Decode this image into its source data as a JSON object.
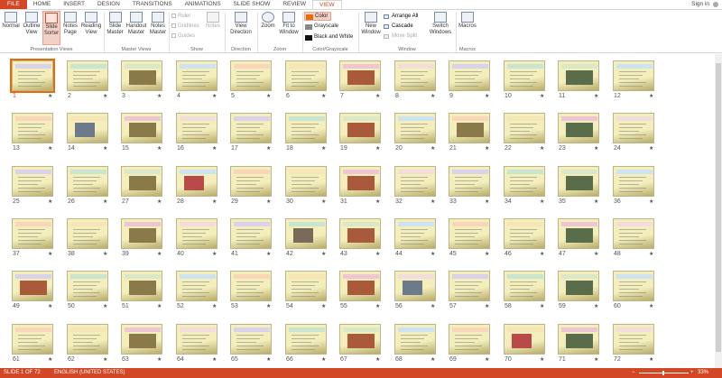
{
  "tabs": [
    "FILE",
    "HOME",
    "INSERT",
    "DESIGN",
    "TRANSITIONS",
    "ANIMATIONS",
    "SLIDE SHOW",
    "REVIEW",
    "VIEW"
  ],
  "signin": "Sign in",
  "ribbon": {
    "presentation_views": {
      "label": "Presentation Views",
      "buttons": [
        "Normal",
        "Outline View",
        "Slide Sorter",
        "Notes Page",
        "Reading View"
      ]
    },
    "master_views": {
      "label": "Master Views",
      "buttons": [
        "Slide Master",
        "Handout Master",
        "Notes Master"
      ]
    },
    "show": {
      "label": "Show",
      "checks": [
        "Ruler",
        "Gridlines",
        "Guides"
      ],
      "notes": "Notes"
    },
    "direction": {
      "label": "Direction",
      "button": "View Direction"
    },
    "zoom": {
      "label": "Zoom",
      "buttons": [
        "Zoom",
        "Fit to Window"
      ]
    },
    "color": {
      "label": "Color/Grayscale",
      "options": [
        "Color",
        "Grayscale",
        "Black and White"
      ],
      "swatches": [
        "#e46c0a",
        "#888888",
        "#111111"
      ]
    },
    "window": {
      "label": "Window",
      "new_window": "New Window",
      "small": [
        "Arrange All",
        "Cascade",
        "Move Split"
      ],
      "switch": "Switch Windows"
    },
    "macros": {
      "label": "Macros",
      "button": "Macros"
    }
  },
  "slides": {
    "count": 72,
    "selected": 1,
    "star": "★"
  },
  "status": {
    "slide": "SLIDE 1 OF 72",
    "language": "ENGLISH (UNITED STATES)",
    "zoom": "33%",
    "minus": "−",
    "plus": "+"
  },
  "colors": {
    "accent": "#d24726",
    "slide_bg": "#f3eebc",
    "slide_edge": "#b9ac6a"
  }
}
